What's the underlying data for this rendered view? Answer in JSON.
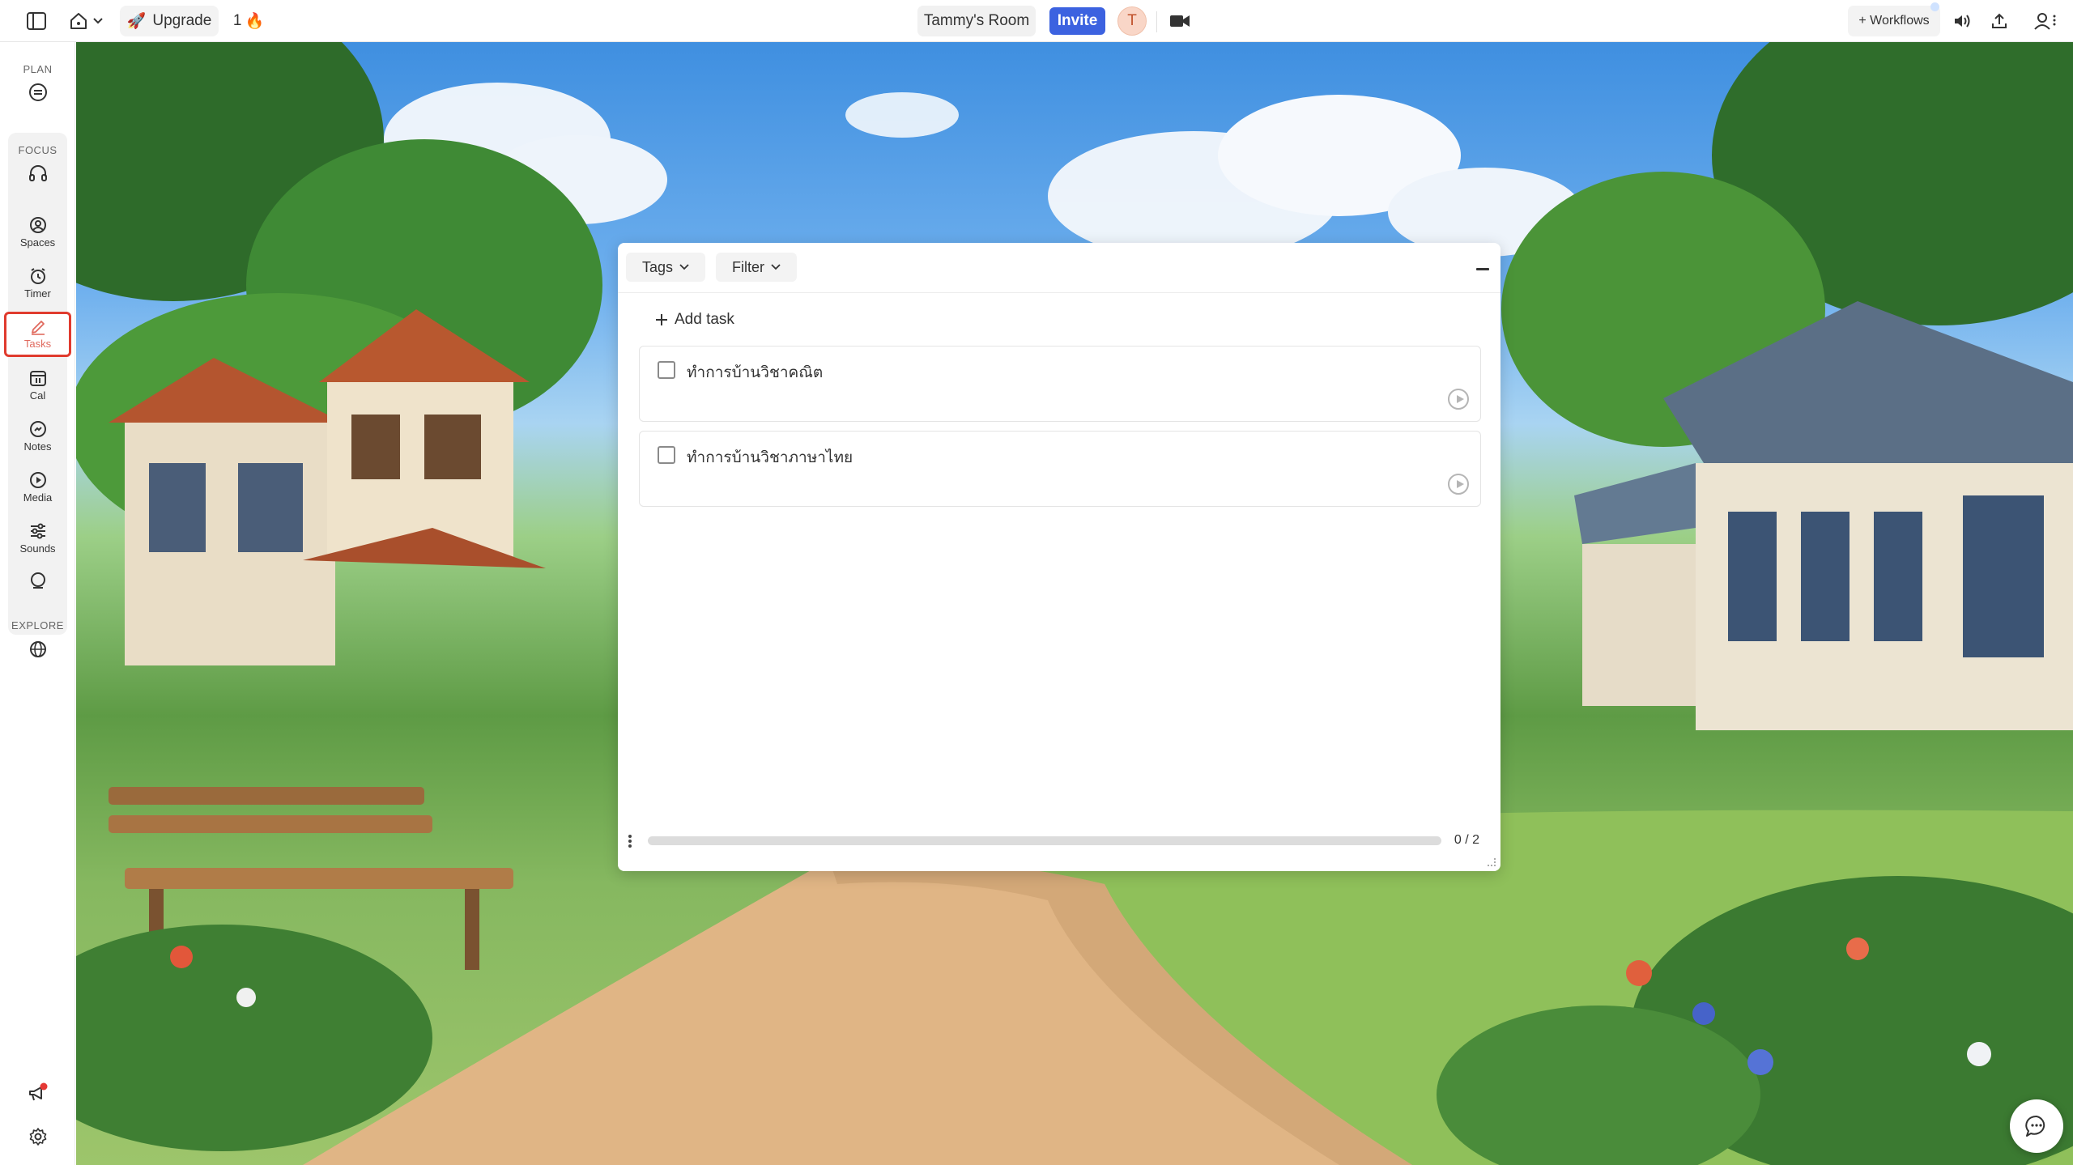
{
  "topbar": {
    "upgrade_label": "Upgrade",
    "streak_count": "1",
    "room_name": "Tammy's Room",
    "invite_label": "Invite",
    "avatar_initial": "T",
    "workflows_label": "+ Workflows"
  },
  "sidebar": {
    "plan_label": "PLAN",
    "focus_label": "FOCUS",
    "explore_label": "EXPLORE",
    "items": [
      {
        "label": "Spaces"
      },
      {
        "label": "Timer"
      },
      {
        "label": "Tasks"
      },
      {
        "label": "Cal"
      },
      {
        "label": "Notes"
      },
      {
        "label": "Media"
      },
      {
        "label": "Sounds"
      }
    ]
  },
  "tasks_panel": {
    "tags_label": "Tags",
    "filter_label": "Filter",
    "add_task_label": "Add task",
    "tasks": [
      {
        "title": "ทำการบ้านวิชาคณิต",
        "done": false
      },
      {
        "title": "ทำการบ้านวิชาภาษาไทย",
        "done": false
      }
    ],
    "progress_fraction": 0,
    "count_label": "0 / 2"
  },
  "colors": {
    "accent": "#3c62e0",
    "active_outline": "#e03b2e",
    "notification_dot": "#e53935"
  }
}
